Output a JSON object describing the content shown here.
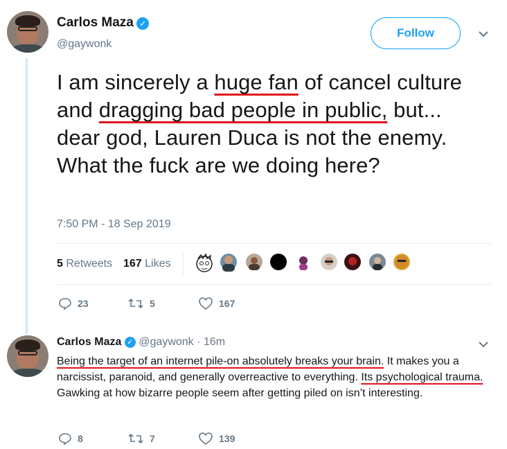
{
  "main_tweet": {
    "author_name": "Carlos Maza",
    "handle": "@gaywonk",
    "follow_label": "Follow",
    "text_parts": [
      {
        "text": "I am sincerely a ",
        "underline": false
      },
      {
        "text": "huge fan",
        "underline": true
      },
      {
        "text": " of cancel culture and ",
        "underline": false
      },
      {
        "text": "dragging bad people in public,",
        "underline": true
      },
      {
        "text": " but... dear god, Lauren Duca is not the enemy. What the fuck are we doing here?",
        "underline": false
      }
    ],
    "timestamp": "7:50 PM - 18 Sep 2019",
    "retweets_count": "5",
    "retweets_label": "Retweets",
    "likes_count": "167",
    "likes_label": "Likes",
    "actions": {
      "replies": "23",
      "retweets": "5",
      "likes": "167"
    }
  },
  "reply_tweet": {
    "author_name": "Carlos Maza",
    "handle": "@gaywonk",
    "age": "· 16m",
    "text_parts": [
      {
        "text": "Being the target of an internet pile-on absolutely breaks your brain.",
        "underline": true
      },
      {
        "text": " It makes you a narcissist, paranoid, and generally overreactive to everything. ",
        "underline": false
      },
      {
        "text": "Its psychological trauma.",
        "underline": true
      },
      {
        "text": " Gawking at how bizarre people seem after getting piled on isn’t interesting.",
        "underline": false
      }
    ],
    "actions": {
      "replies": "8",
      "retweets": "7",
      "likes": "139"
    }
  },
  "colors": {
    "accent": "#1da1f2",
    "underline": "#e0121c",
    "muted": "#657786"
  }
}
